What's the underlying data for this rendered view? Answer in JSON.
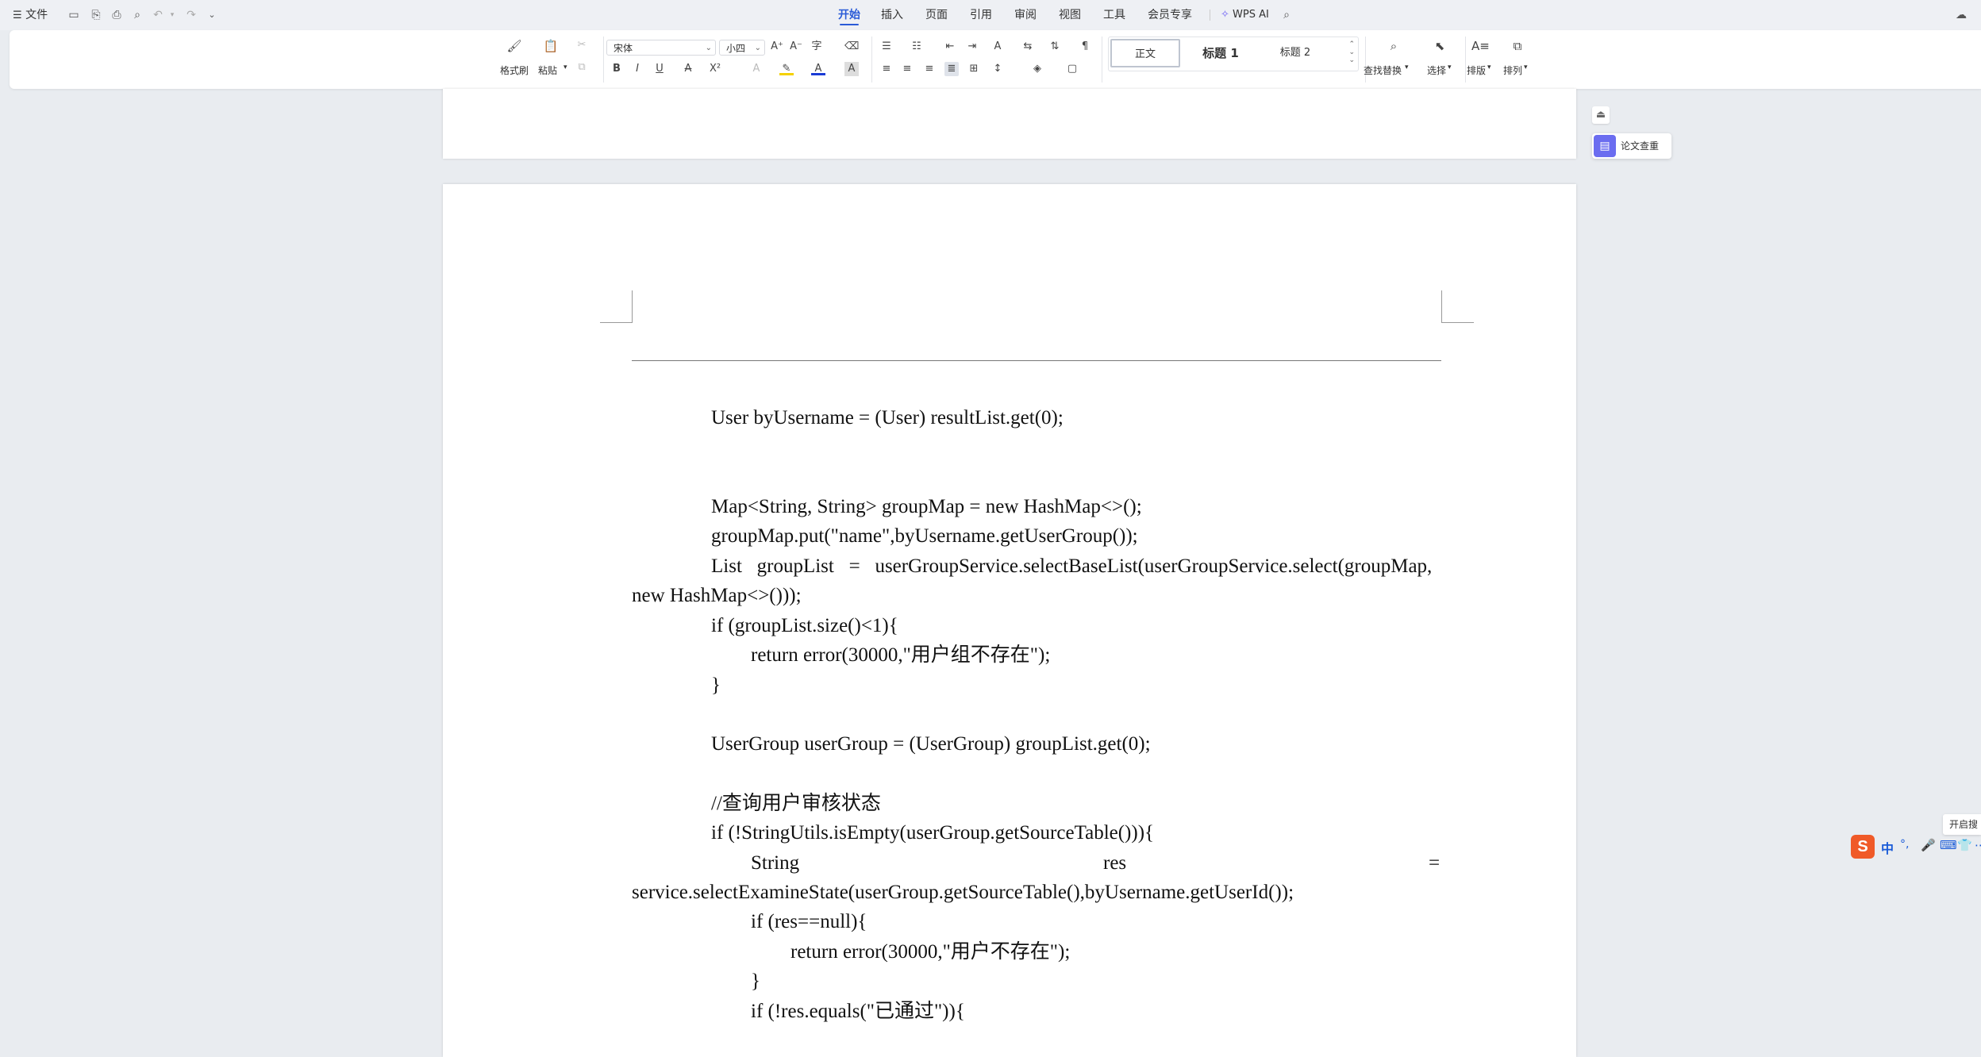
{
  "topbar": {
    "menu_label": "文件",
    "tabs": [
      "开始",
      "插入",
      "页面",
      "引用",
      "审阅",
      "视图",
      "工具",
      "会员专享"
    ],
    "active_tab": "开始",
    "wps_ai": "WPS AI"
  },
  "ribbon": {
    "format_painter": "格式刷",
    "paste": "粘贴",
    "font_name": "宋体",
    "font_size": "小四",
    "styles": [
      "正文",
      "标题 1",
      "标题 2"
    ],
    "find_replace": "查找替换",
    "select": "选择",
    "layout": "排版",
    "arrange": "排列"
  },
  "side_panel": {
    "label": "论文查重"
  },
  "tooltip": {
    "label": "开启搜"
  },
  "ime": {
    "lang": "中"
  },
  "document": {
    "line1": "User byUsername = (User) resultList.get(0);",
    "line2": "Map<String, String> groupMap = new HashMap<>();",
    "line3": "groupMap.put(\"name\",byUsername.getUserGroup());",
    "line4a": "List   groupList   =   userGroupService.selectBaseList(userGroupService.select(groupMap,",
    "line4b": "new HashMap<>()));",
    "line5": "if (groupList.size()<1){",
    "line6": "return error(30000,\"用户组不存在\");",
    "line7": "}",
    "line8": "UserGroup userGroup = (UserGroup) groupList.get(0);",
    "line9": "//查询用户审核状态",
    "line10": "if (!StringUtils.isEmpty(userGroup.getSourceTable())){",
    "line11a_1": "String",
    "line11a_2": "res",
    "line11a_3": "=",
    "line11b": "service.selectExamineState(userGroup.getSourceTable(),byUsername.getUserId());",
    "line12": "if (res==null){",
    "line13": "return error(30000,\"用户不存在\");",
    "line14": "}",
    "line15": "if (!res.equals(\"已通过\")){"
  }
}
